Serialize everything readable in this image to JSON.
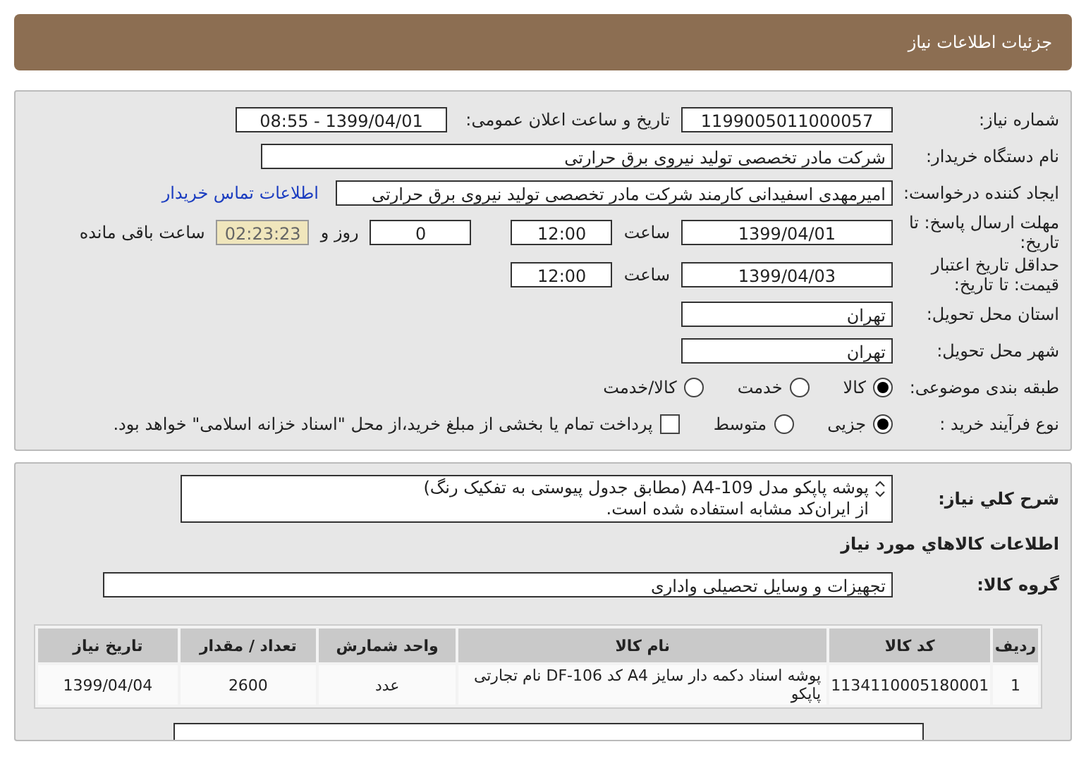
{
  "header": {
    "title": "جزئیات اطلاعات نیاز"
  },
  "need_number": {
    "label": "شماره نیاز:",
    "value": "1199005011000057"
  },
  "announce": {
    "label": "تاریخ و ساعت اعلان عمومی:",
    "value": "1399/04/01 - 08:55"
  },
  "buyer": {
    "label": "نام دستگاه خریدار:",
    "value": "شرکت مادر تخصصی تولید نیروی برق حرارتی"
  },
  "requester": {
    "label": "ایجاد کننده درخواست:",
    "value": "امیرمهدی اسفیدانی کارمند شرکت مادر تخصصی تولید نیروی برق حرارتی",
    "contact_link": "اطلاعات تماس خریدار"
  },
  "deadline": {
    "label": "مهلت ارسال پاسخ: تا تاریخ:",
    "date": "1399/04/01",
    "time_label": "ساعت",
    "time": "12:00",
    "days": "0",
    "days_label": "روز و",
    "countdown": "02:23:23",
    "remaining_label": "ساعت باقی مانده"
  },
  "validity": {
    "label": "حداقل تاریخ اعتبار قیمت: تا تاریخ:",
    "date": "1399/04/03",
    "time_label": "ساعت",
    "time": "12:00"
  },
  "province": {
    "label": "استان محل تحویل:",
    "value": "تهران"
  },
  "city": {
    "label": "شهر محل تحویل:",
    "value": "تهران"
  },
  "category": {
    "label": "طبقه بندی موضوعی:",
    "options": [
      {
        "label": "کالا",
        "selected": true
      },
      {
        "label": "خدمت",
        "selected": false
      },
      {
        "label": "کالا/خدمت",
        "selected": false
      }
    ]
  },
  "process": {
    "label": "نوع فرآیند خرید :",
    "options": [
      {
        "label": "جزیی",
        "selected": true
      },
      {
        "label": "متوسط",
        "selected": false
      }
    ],
    "payment_checkbox": {
      "checked": false,
      "label": "پرداخت تمام یا بخشی از مبلغ خرید،از محل \"اسناد خزانه اسلامی\" خواهد بود."
    }
  },
  "description": {
    "label": "شرح کلي نياز:",
    "lines": [
      "پوشه پاپکو مدل A4-109 (مطابق جدول پیوستی به تفکیک رنگ)",
      "از ایران‌کد مشابه استفاده شده است."
    ]
  },
  "goods_section": {
    "title": "اطلاعات کالاهاي مورد نياز"
  },
  "goods_group": {
    "label": "گروه کالا:",
    "value": "تجهیزات و وسایل تحصیلی واداری"
  },
  "table": {
    "columns": [
      "ردیف",
      "کد کالا",
      "نام کالا",
      "واحد شمارش",
      "تعداد / مقدار",
      "تاریخ نیاز"
    ],
    "rows": [
      [
        "1",
        "1134110005180001",
        "پوشه اسناد دکمه دار سایز A4 کد DF-106 نام تجارتی پاپکو",
        "عدد",
        "2600",
        "1399/04/04"
      ]
    ]
  }
}
